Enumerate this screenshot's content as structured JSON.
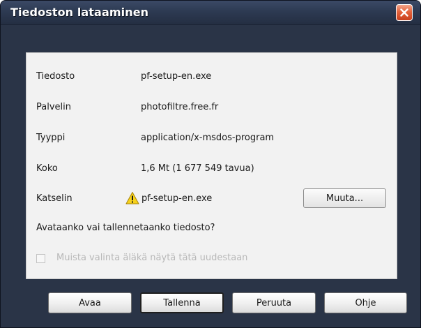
{
  "window": {
    "title": "Tiedoston lataaminen",
    "close_icon": "close-icon",
    "title_bar_color": "#2d3a52",
    "close_color": "#e4633c"
  },
  "info": {
    "file_label": "Tiedosto",
    "file_value": "pf-setup-en.exe",
    "server_label": "Palvelin",
    "server_value": "photofiltre.free.fr",
    "type_label": "Tyyppi",
    "type_value": "application/x-msdos-program",
    "size_label": "Koko",
    "size_value": "1,6 Mt (1 677 549 tavua)",
    "viewer_label": "Katselin",
    "viewer_icon": "warning-icon",
    "viewer_value": "pf-setup-en.exe",
    "change_button": "Muuta..."
  },
  "question": "Avataanko vai tallennetaanko tiedosto?",
  "remember": {
    "label": "Muista valinta äläkä näytä tätä uudestaan",
    "checked": false,
    "enabled": false
  },
  "buttons": {
    "open": "Avaa",
    "save": "Tallenna",
    "cancel": "Peruuta",
    "help": "Ohje"
  }
}
